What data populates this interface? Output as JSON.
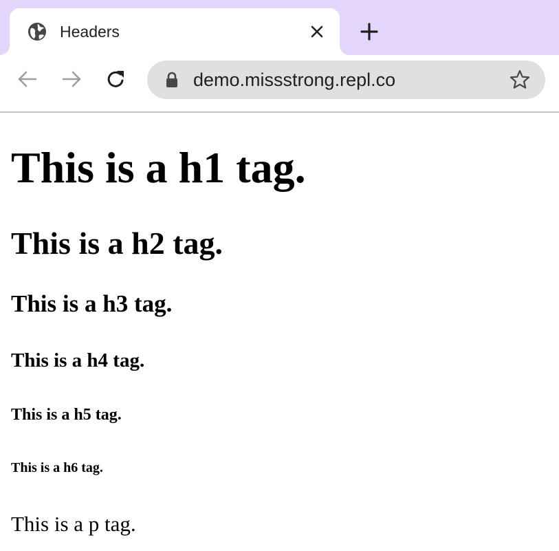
{
  "browser": {
    "tab": {
      "title": "Headers",
      "favicon": "globe-icon",
      "close_icon": "close-icon"
    },
    "new_tab_icon": "plus-icon",
    "toolbar": {
      "back_icon": "arrow-left-icon",
      "forward_icon": "arrow-right-icon",
      "reload_icon": "reload-icon",
      "lock_icon": "lock-icon",
      "url": "demo.missstrong.repl.co",
      "bookmark_icon": "star-icon"
    },
    "colors": {
      "tab_strip": "#e3d5fb",
      "omnibox": "#e0e0e0"
    }
  },
  "page": {
    "h1": "This is a h1 tag.",
    "h2": "This is a h2 tag.",
    "h3": "This is a h3 tag.",
    "h4": "This is a h4 tag.",
    "h5": "This is a h5 tag.",
    "h6": "This is a h6 tag.",
    "p": "This is a p tag."
  }
}
